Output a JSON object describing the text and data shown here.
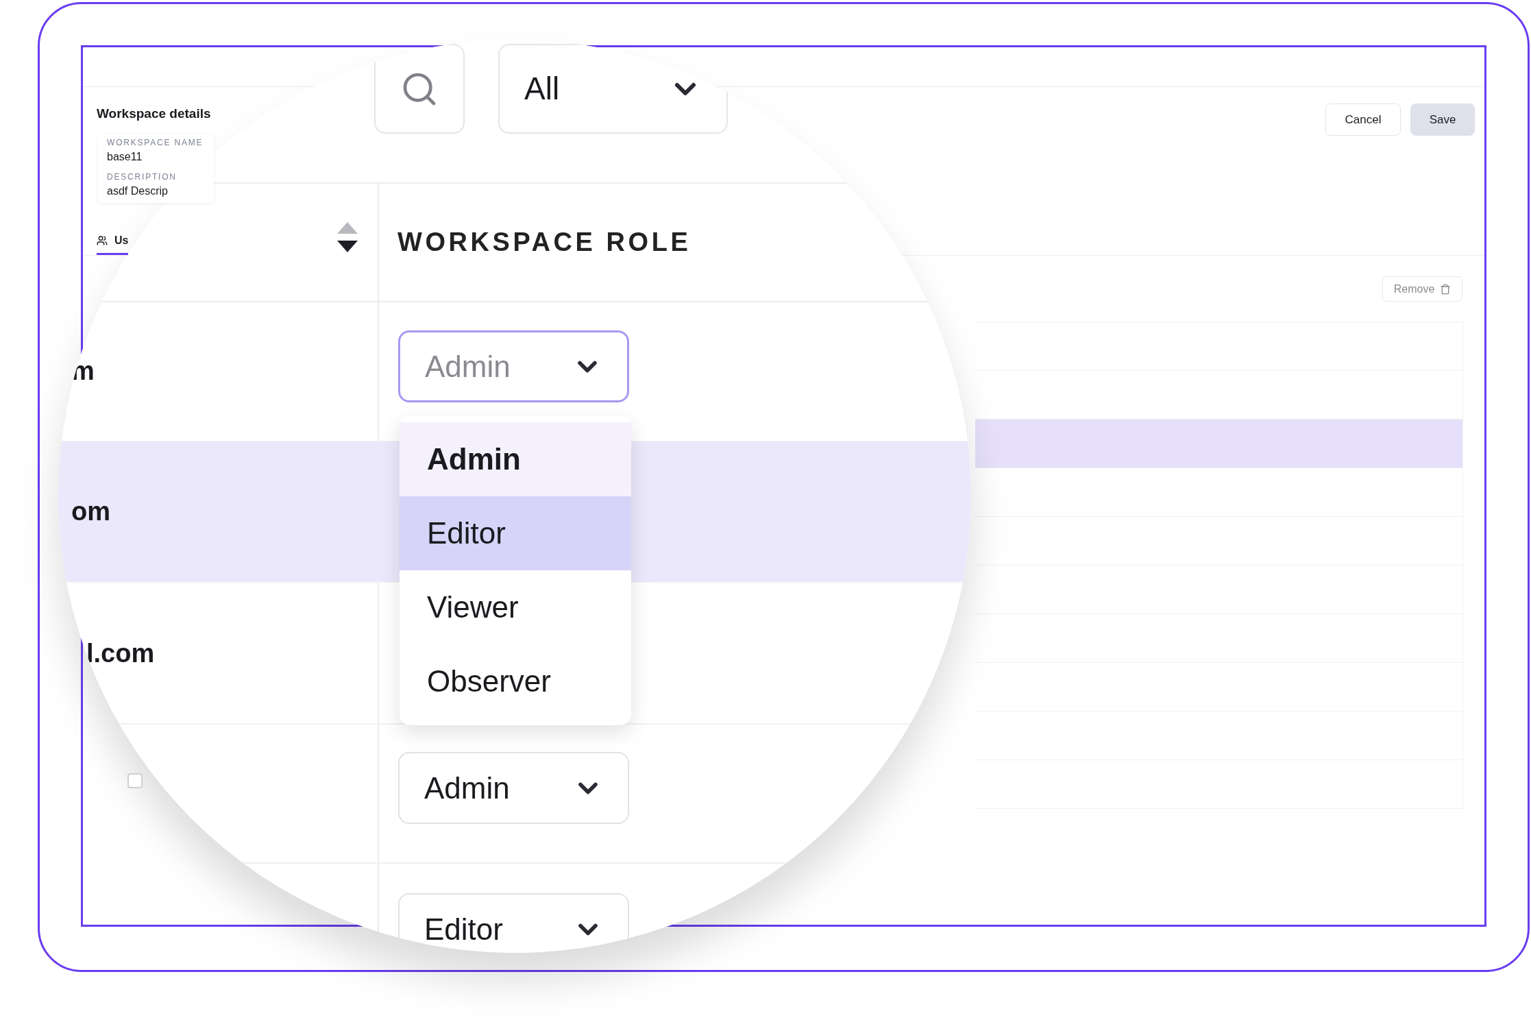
{
  "details": {
    "title": "Workspace details",
    "fields": [
      {
        "label": "WORKSPACE NAME",
        "value": "base11"
      },
      {
        "label": "DESCRIPTION",
        "value": "asdf Descrip"
      }
    ]
  },
  "actions": [
    {
      "label": "Cancel",
      "kind": "secondary"
    },
    {
      "label": "Save",
      "kind": "primary"
    }
  ],
  "tabs": [
    {
      "label": "Us",
      "selected": true
    }
  ],
  "remove_button": "Remove",
  "row_checkbox": {
    "checked": false
  },
  "table": {
    "rows": [
      {
        "selected": false
      },
      {
        "selected": false
      },
      {
        "selected": true
      },
      {
        "selected": false
      },
      {
        "selected": false
      },
      {
        "selected": false
      },
      {
        "selected": false
      },
      {
        "selected": false
      },
      {
        "selected": false
      },
      {
        "selected": false
      }
    ]
  },
  "magnifier": {
    "filter": "All",
    "column_header": "WORKSPACE ROLE",
    "rows": [
      {
        "email": "m",
        "role": "Admin",
        "open": true,
        "selected": false
      },
      {
        "email": "om",
        "selected": true
      },
      {
        "email": "l.com",
        "selected": false
      },
      {
        "role": "Admin",
        "open": false,
        "selected": false
      },
      {
        "role": "Editor",
        "open": false,
        "selected": false
      }
    ],
    "menu": [
      {
        "label": "Admin",
        "selected": true,
        "highlighted": false
      },
      {
        "label": "Editor",
        "selected": false,
        "highlighted": true
      },
      {
        "label": "Viewer",
        "selected": false,
        "highlighted": false
      },
      {
        "label": "Observer",
        "selected": false,
        "highlighted": false
      }
    ]
  }
}
